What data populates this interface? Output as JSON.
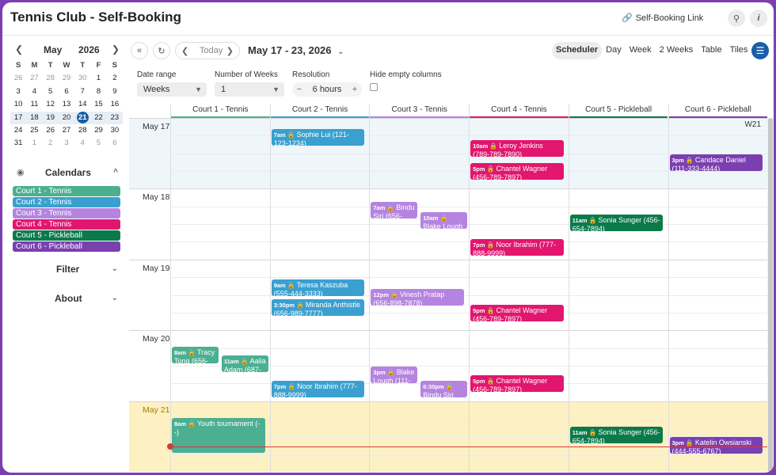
{
  "app": {
    "title": "Tennis Club - Self-Booking",
    "self_booking_link": "Self-Booking Link"
  },
  "mini_calendar": {
    "month": "May",
    "year": "2026",
    "dow": [
      "S",
      "M",
      "T",
      "W",
      "T",
      "F",
      "S"
    ],
    "weeks": [
      [
        "26",
        "27",
        "28",
        "29",
        "30",
        "1",
        "2"
      ],
      [
        "3",
        "4",
        "5",
        "6",
        "7",
        "8",
        "9"
      ],
      [
        "10",
        "11",
        "12",
        "13",
        "14",
        "15",
        "16"
      ],
      [
        "17",
        "18",
        "19",
        "20",
        "21",
        "22",
        "23"
      ],
      [
        "24",
        "25",
        "26",
        "27",
        "28",
        "29",
        "30"
      ],
      [
        "31",
        "1",
        "2",
        "3",
        "4",
        "5",
        "6"
      ]
    ],
    "today": "21"
  },
  "sidebar": {
    "calendars_label": "Calendars",
    "calendars": [
      {
        "label": "Court 1 - Tennis",
        "color": "#4caf91"
      },
      {
        "label": "Court 2 - Tennis",
        "color": "#3aa0cf"
      },
      {
        "label": "Court 3 - Tennis",
        "color": "#b584e0"
      },
      {
        "label": "Court 4 - Tennis",
        "color": "#e2166e"
      },
      {
        "label": "Court 5 - Pickleball",
        "color": "#0b7a4b"
      },
      {
        "label": "Court 6 - Pickleball",
        "color": "#7b3fb0"
      }
    ],
    "filter_label": "Filter",
    "about_label": "About"
  },
  "toolbar": {
    "today_label": "Today",
    "range_label": "May 17 - 23, 2026",
    "views": [
      "Scheduler",
      "Day",
      "Week",
      "2 Weeks",
      "Table",
      "Tiles"
    ],
    "active_view": "Scheduler"
  },
  "options": {
    "date_range_label": "Date range",
    "date_range_value": "Weeks",
    "num_weeks_label": "Number of Weeks",
    "num_weeks_value": "1",
    "resolution_label": "Resolution",
    "resolution_value": "6 hours",
    "hide_empty_label": "Hide empty columns"
  },
  "resources": [
    {
      "label": "Court 1 - Tennis",
      "color": "#4caf91"
    },
    {
      "label": "Court 2 - Tennis",
      "color": "#3aa0cf"
    },
    {
      "label": "Court 3 - Tennis",
      "color": "#b584e0"
    },
    {
      "label": "Court 4 - Tennis",
      "color": "#e2166e"
    },
    {
      "label": "Court 5 - Pickleball",
      "color": "#0b7a4b"
    },
    {
      "label": "Court 6 - Pickleball",
      "color": "#7b3fb0"
    }
  ],
  "days": [
    "May 17",
    "May 18",
    "May 19",
    "May 20",
    "May 21"
  ],
  "week_badge": "W21",
  "events": [
    {
      "day": 0,
      "res": 1,
      "slot": 1,
      "time": "7am",
      "text": "Sophie Lui (121-123-1234)"
    },
    {
      "day": 0,
      "res": 3,
      "slot": 1.6,
      "time": "10am",
      "text": "Leroy Jenkins (789-789-7890)"
    },
    {
      "day": 0,
      "res": 3,
      "slot": 2.9,
      "time": "5pm",
      "text": "Chantel Wagner (456-789-7897)"
    },
    {
      "day": 0,
      "res": 5,
      "slot": 2.4,
      "time": "3pm",
      "text": "Candace Daniel (111-333-4444)"
    },
    {
      "day": 1,
      "res": 2,
      "slot": 1.1,
      "half": 0,
      "time": "7am",
      "text": "Bindu Siri (656-"
    },
    {
      "day": 1,
      "res": 2,
      "slot": 1.7,
      "half": 1,
      "time": "10am",
      "text": "Blake Lough (111-"
    },
    {
      "day": 1,
      "res": 4,
      "slot": 1.8,
      "time": "11am",
      "text": "Sonia Sunger (456-654-7894)"
    },
    {
      "day": 1,
      "res": 3,
      "slot": 3.2,
      "time": "7pm",
      "text": "Noor Ibrahim (777-888-9999)"
    },
    {
      "day": 2,
      "res": 1,
      "slot": 1.5,
      "time": "9am",
      "text": "Teresa Kaszuba (555-444-3333)"
    },
    {
      "day": 2,
      "res": 1,
      "slot": 2.6,
      "time": "3:30pm",
      "text": "Miranda Anthistle (656-989-7777)"
    },
    {
      "day": 2,
      "res": 2,
      "slot": 2.0,
      "time": "12pm",
      "text": "Vinesh Pratap (656-898-7878)"
    },
    {
      "day": 2,
      "res": 3,
      "slot": 2.9,
      "time": "5pm",
      "text": "Chantel Wagner (456-789-7897)"
    },
    {
      "day": 3,
      "res": 0,
      "slot": 1.3,
      "half": 0,
      "time": "8am",
      "text": "Tracy Tong (656-"
    },
    {
      "day": 3,
      "res": 0,
      "slot": 1.8,
      "half": 1,
      "time": "11am",
      "text": "Aalia Adam (687-"
    },
    {
      "day": 3,
      "res": 1,
      "slot": 3.2,
      "time": "7pm",
      "text": "Noor Ibrahim (777-888-9999)"
    },
    {
      "day": 3,
      "res": 2,
      "slot": 2.4,
      "half": 0,
      "time": "3pm",
      "text": "Blake Lough (111-"
    },
    {
      "day": 3,
      "res": 2,
      "slot": 3.2,
      "half": 1,
      "time": "6:30pm",
      "text": "Bindu Siri"
    },
    {
      "day": 3,
      "res": 3,
      "slot": 2.9,
      "time": "5pm",
      "text": "Chantel Wagner (456-789-7897)"
    },
    {
      "day": 4,
      "res": 0,
      "slot": 1.3,
      "time": "8am",
      "text": "Youth tournament (--)",
      "tall": true
    },
    {
      "day": 4,
      "res": 4,
      "slot": 1.8,
      "time": "11am",
      "text": "Sonia Sunger (456-654-7894)"
    },
    {
      "day": 4,
      "res": 5,
      "slot": 2.4,
      "time": "3pm",
      "text": "Katelin Owsianski (444-555-6767)"
    }
  ]
}
